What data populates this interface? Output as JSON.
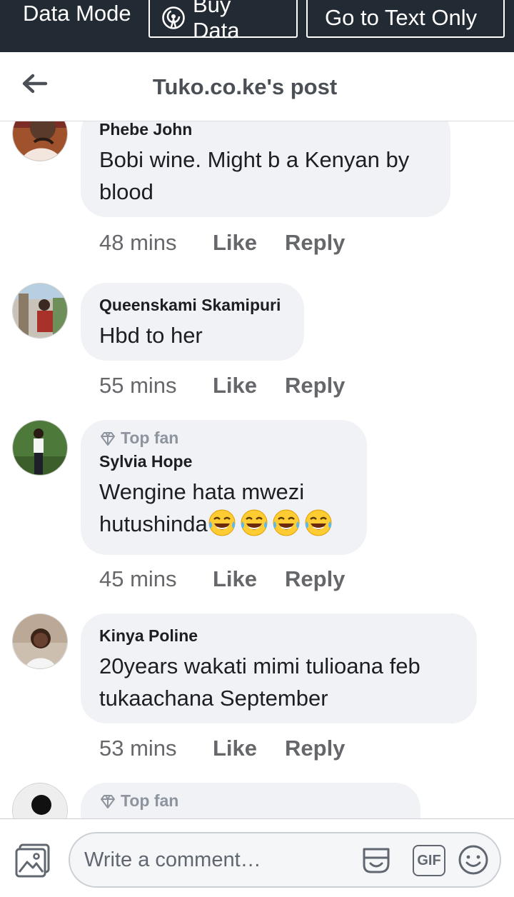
{
  "topbar": {
    "mode_label": "Data Mode",
    "buy_label": "Buy Data",
    "text_only_label": "Go to Text Only"
  },
  "header": {
    "title": "Tuko.co.ke's post"
  },
  "actions": {
    "like": "Like",
    "reply": "Reply"
  },
  "comments": [
    {
      "top_fan": "",
      "name": "Phebe John",
      "text": "Bobi wine. Might b a Kenyan by blood",
      "time": "48 mins"
    },
    {
      "top_fan": "",
      "name": "Queenskami Skamipuri",
      "text": "Hbd to her",
      "time": "55 mins"
    },
    {
      "top_fan": "Top fan",
      "name": "Sylvia Hope",
      "text": "Wengine hata mwezi hutushinda",
      "emojis": [
        "tears-of-joy",
        "tears-of-joy",
        "tears-of-joy",
        "tears-of-joy"
      ],
      "time": "45 mins"
    },
    {
      "top_fan": "",
      "name": "Kinya Poline",
      "text": "20years wakati mimi  tulioana feb tukaachana September",
      "time": "53 mins"
    },
    {
      "top_fan": "Top fan",
      "name": "",
      "text": "",
      "time": ""
    }
  ],
  "composer": {
    "placeholder": "Write a comment…",
    "gif_label": "GIF"
  },
  "colors": {
    "topbar_bg": "#222a33",
    "bubble_bg": "#f0f2f5",
    "meta_text": "#65676b"
  }
}
